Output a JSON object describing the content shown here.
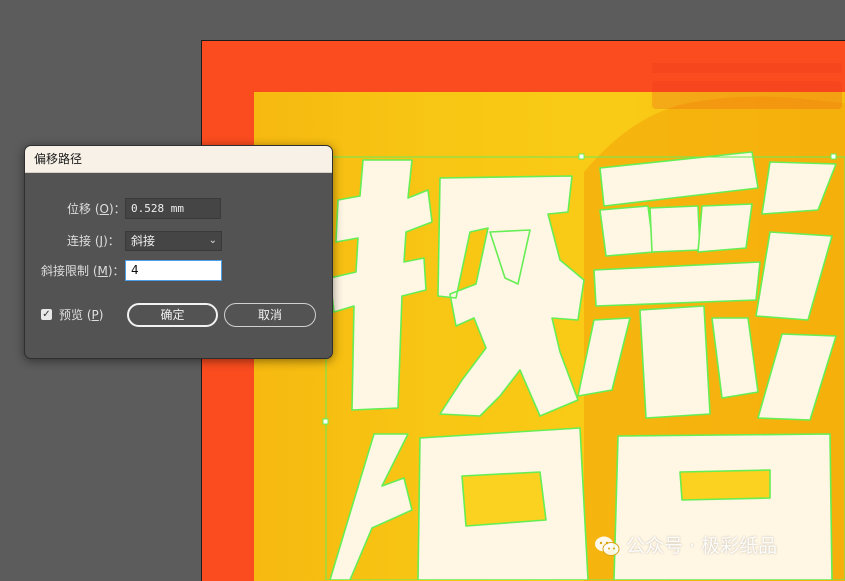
{
  "dialog": {
    "title": "偏移路径",
    "offset": {
      "label": "位移",
      "accel": "O",
      "value": "0.528 mm"
    },
    "join": {
      "label": "连接",
      "accel": "J",
      "value": "斜接"
    },
    "miter_limit": {
      "label": "斜接限制",
      "accel": "M",
      "value": "4"
    },
    "preview": {
      "label": "预览",
      "accel": "P",
      "checked": true
    },
    "ok_label": "确定",
    "cancel_label": "取消"
  },
  "artwork": {
    "chars": [
      "极",
      "彩",
      "纸",
      "品"
    ],
    "logo_icon": "colorfox-logo",
    "colors": {
      "canvas": "#5c5c5c",
      "border": "#fb4c1f",
      "inner": "#fdd71f",
      "letter_fill": "#fff6e4",
      "selection": "#66ee55",
      "annotation": "#d81e2a"
    }
  },
  "footer_watermark": {
    "icon": "wechat-icon",
    "text": "公众号 · 极彩纸品"
  }
}
